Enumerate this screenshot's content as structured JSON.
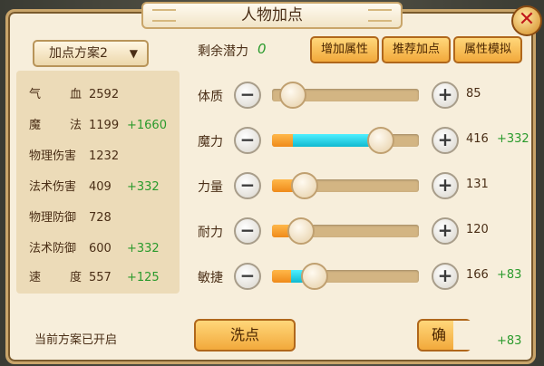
{
  "title": "人物加点",
  "close_icon": "close-x-icon",
  "scheme_select": {
    "label": "加点方案2",
    "chevron": "⌄"
  },
  "stats": [
    {
      "label": "气 血",
      "value": "2592",
      "bonus": ""
    },
    {
      "label": "魔 法",
      "value": "1199",
      "bonus": "+1660"
    },
    {
      "label": "物理伤害",
      "value": "1232",
      "bonus": ""
    },
    {
      "label": "法术伤害",
      "value": "409",
      "bonus": "+332"
    },
    {
      "label": "物理防御",
      "value": "728",
      "bonus": ""
    },
    {
      "label": "法术防御",
      "value": "600",
      "bonus": "+332"
    },
    {
      "label": "速 度",
      "value": "557",
      "bonus": "+125"
    }
  ],
  "status_text": "当前方案已开启",
  "potential": {
    "label": "剩余潜力",
    "value": "0"
  },
  "top_buttons": [
    "增加属性",
    "推荐加点",
    "属性模拟"
  ],
  "attributes": [
    {
      "name": "体质",
      "value": "85",
      "bonus": "",
      "base_fraction": 0.0,
      "added_fraction": 0.0,
      "knob_fraction": 0.14
    },
    {
      "name": "魔力",
      "value": "416",
      "bonus": "+332",
      "base_fraction": 0.14,
      "added_fraction": 0.6,
      "knob_fraction": 0.74
    },
    {
      "name": "力量",
      "value": "131",
      "bonus": "",
      "base_fraction": 0.22,
      "added_fraction": 0.0,
      "knob_fraction": 0.22
    },
    {
      "name": "耐力",
      "value": "120",
      "bonus": "",
      "base_fraction": 0.2,
      "added_fraction": 0.0,
      "knob_fraction": 0.2
    },
    {
      "name": "敏捷",
      "value": "166",
      "bonus": "+83",
      "base_fraction": 0.13,
      "added_fraction": 0.16,
      "knob_fraction": 0.29
    }
  ],
  "buttons": {
    "wash": "洗点",
    "confirm": "确"
  },
  "bottom_bonus": "+83",
  "colors": {
    "bonus_green": "#2a9a2c",
    "accent_orange": "#f2a93b",
    "fill_cyan": "#10b9d0"
  }
}
